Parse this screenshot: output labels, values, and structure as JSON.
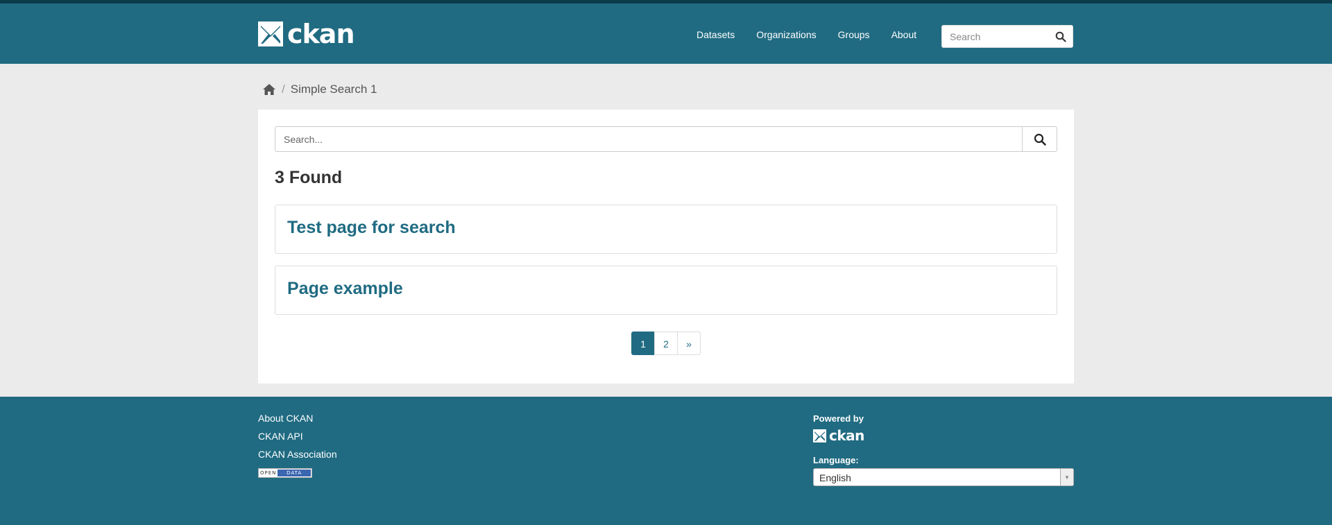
{
  "header": {
    "logo_text": "ckan",
    "nav": [
      "Datasets",
      "Organizations",
      "Groups",
      "About"
    ],
    "search_placeholder": "Search"
  },
  "breadcrumb": {
    "current": "Simple Search 1"
  },
  "search": {
    "placeholder": "Search..."
  },
  "results": {
    "count_text": "3 Found",
    "items": [
      "Test page for search",
      "Page example"
    ]
  },
  "pagination": {
    "pages": [
      "1",
      "2"
    ],
    "active": "1",
    "next_label": "»"
  },
  "footer": {
    "links": [
      "About CKAN",
      "CKAN API",
      "CKAN Association"
    ],
    "badge_left": "OPEN",
    "badge_right": "DATA",
    "powered_by": "Powered by",
    "logo_text": "ckan",
    "language_label": "Language:",
    "language_value": "English"
  },
  "colors": {
    "brand": "#206b82",
    "page_bg": "#ebebeb",
    "link": "#206b82"
  }
}
